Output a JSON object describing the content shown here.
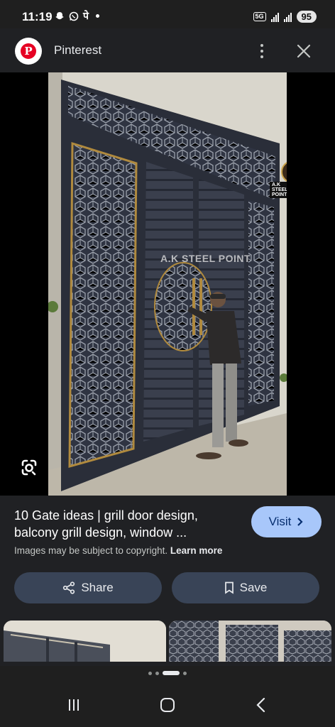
{
  "status_bar": {
    "time": "11:19",
    "left_glyph": "पे",
    "network": "5G",
    "battery": "95"
  },
  "header": {
    "site_name": "Pinterest",
    "logo_letter": "P",
    "menu_icon": "more-vert-icon",
    "close_icon": "close-icon"
  },
  "image": {
    "watermark": "A.K STEEL POINT",
    "brand_label": "A.K STEEL POINT",
    "lens_icon": "google-lens-icon"
  },
  "info": {
    "title": "10 Gate ideas | grill door design, balcony grill design, window ...",
    "visit_label": "Visit",
    "copyright_text": "Images may be subject to copyright.",
    "learn_more": "Learn more",
    "share_label": "Share",
    "save_label": "Save"
  },
  "pager": {
    "count": 4,
    "active": 2
  },
  "colors": {
    "background": "#1f1f1f",
    "panel": "#202124",
    "visit_button": "#a8c7fa",
    "action_button": "#394457",
    "pinterest_red": "#e60023"
  }
}
